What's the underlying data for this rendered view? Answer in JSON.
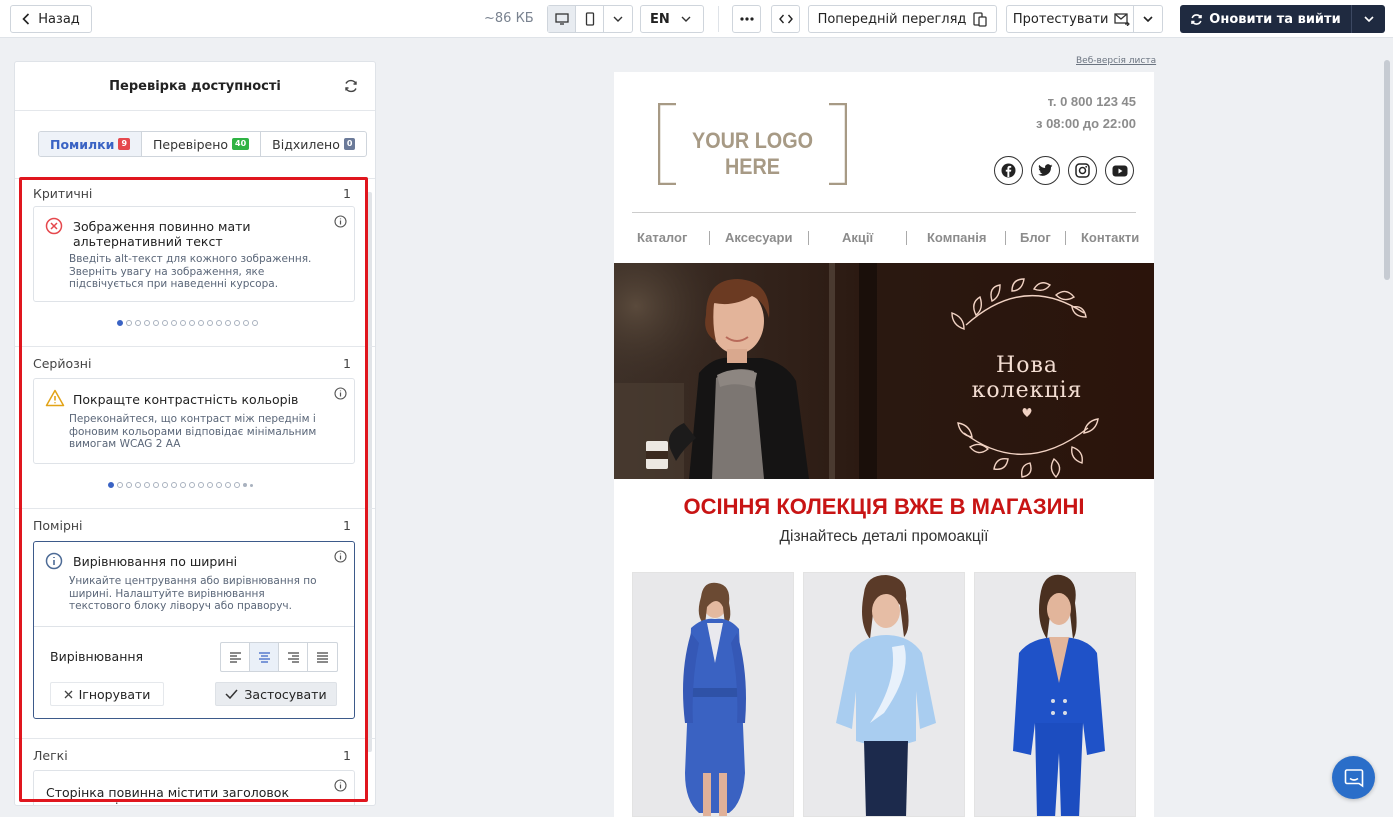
{
  "topbar": {
    "back_label": "Назад",
    "size": "~86 КБ",
    "language": "EN",
    "preview_label": "Попередній перегляд",
    "test_label": "Протестувати",
    "update_label": "Оновити та вийти"
  },
  "panel": {
    "title": "Перевірка доступності",
    "tabs": [
      {
        "label": "Помилки",
        "count": "9",
        "color": "#e5484d"
      },
      {
        "label": "Перевірено",
        "count": "40",
        "color": "#2fb344"
      },
      {
        "label": "Відхилено",
        "count": "0",
        "color": "#6b7a99"
      }
    ],
    "sections": [
      {
        "name": "Критичні",
        "count": "1",
        "card": {
          "title": "Зображення повинно мати альтернативний текст",
          "desc": "Введіть alt-текст для кожного зображення. Зверніть увагу на зображення, яке підсвічується при наведенні курсора.",
          "icon": "error-circle-icon"
        }
      },
      {
        "name": "Серйозні",
        "count": "1",
        "card": {
          "title": "Покращте контрастність кольорів",
          "desc": "Переконайтеся, що контраст між переднім і фоновим кольорами відповідає мінімальним вимогам WCAG 2 AA",
          "icon": "warning-triangle-icon"
        }
      },
      {
        "name": "Помірні",
        "count": "1",
        "card": {
          "title": "Вирівнювання по ширині",
          "desc": "Уникайте центрування або вирівнювання по ширині. Налаштуйте вирівнювання текстового блоку ліворуч або праворуч.",
          "icon": "info-circle-icon",
          "align_label": "Вирівнювання",
          "ignore_label": "Ігнорувати",
          "apply_label": "Застосувати"
        }
      },
      {
        "name": "Легкі",
        "count": "1",
        "card": {
          "title": "Сторінка повинна містити заголовок першого рівня"
        }
      }
    ]
  },
  "email": {
    "web_version": "Веб-версія листа",
    "logo_text": "YOUR LOGO HERE",
    "phone": "т. 0 800 123 45",
    "hours": "з 08:00 до 22:00",
    "nav": [
      "Каталог",
      "Аксесуари",
      "Акції",
      "Компанія",
      "Блог",
      "Контакти"
    ],
    "hero_text": "Нова колекція",
    "headline": "ОСІННЯ КОЛЕКЦІЯ ВЖЕ В МАГАЗИНІ",
    "subheadline": "Дізнайтесь деталі промоакції"
  },
  "colors": {
    "accent": "#3a63c4",
    "primary_button": "#1f2a40",
    "highlight": "#e0161e",
    "headline": "#c81414"
  }
}
